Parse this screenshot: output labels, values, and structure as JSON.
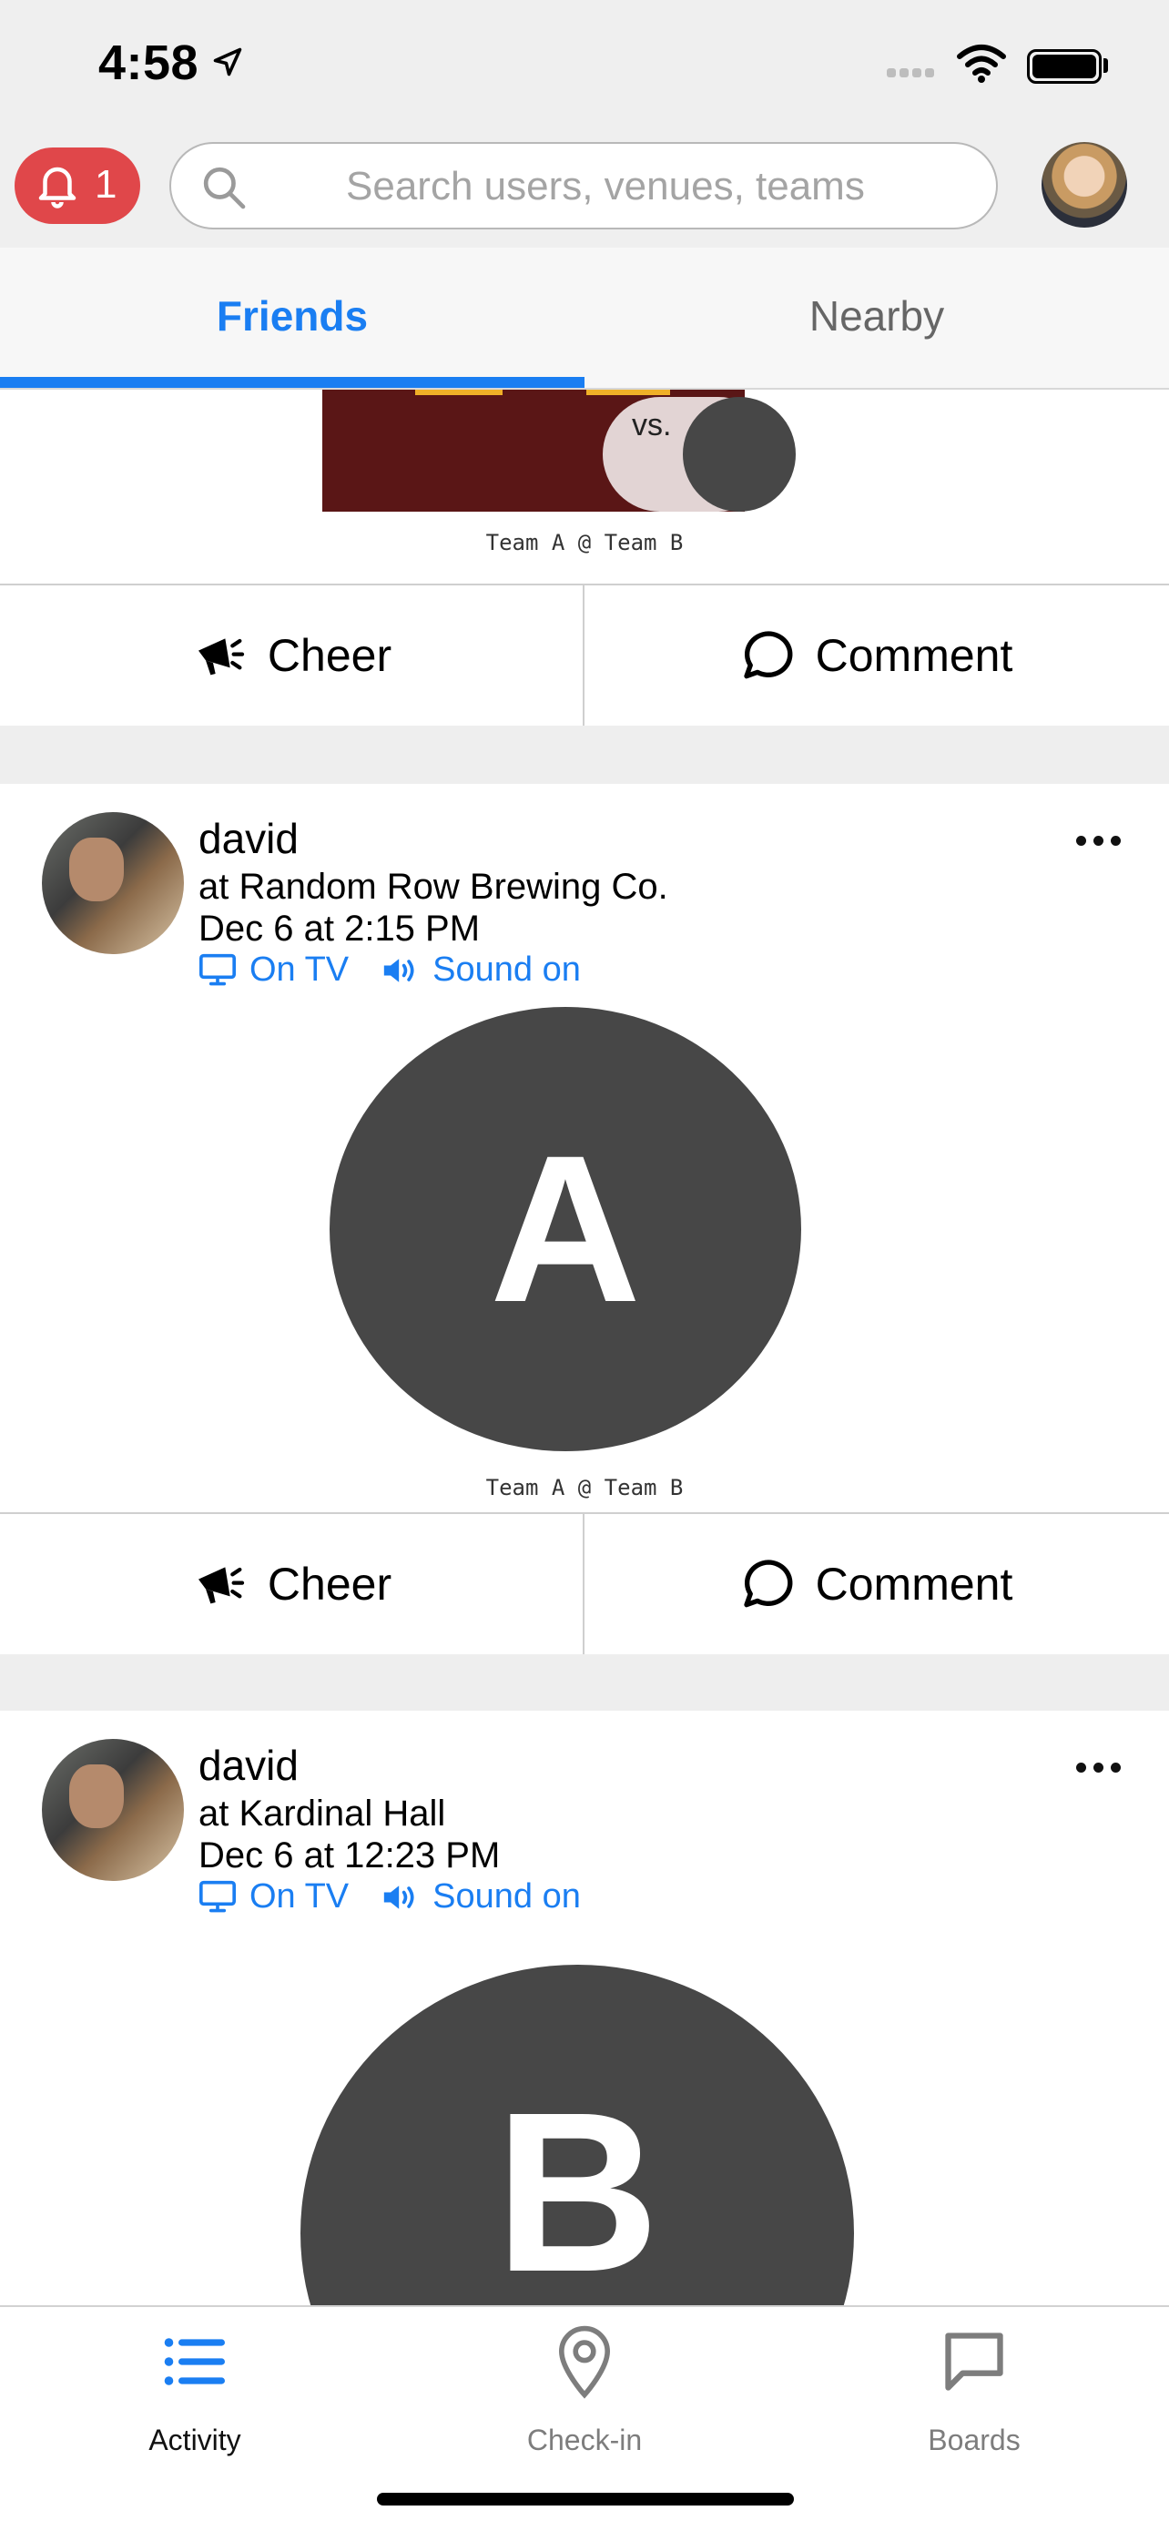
{
  "status_bar": {
    "time": "4:58"
  },
  "header": {
    "notification_count": "1",
    "search_placeholder": "Search users, venues, teams"
  },
  "tabs": {
    "friends": "Friends",
    "nearby": "Nearby"
  },
  "posts": [
    {
      "caption": "Team A @ Team B",
      "vs": "vs.",
      "cheer": "Cheer",
      "comment": "Comment"
    },
    {
      "user": "david",
      "venue": "at Random Row Brewing Co.",
      "time": "Dec 6 at 2:15 PM",
      "on_tv": "On TV",
      "sound": "Sound on",
      "team_letter": "A",
      "caption": "Team A @ Team B",
      "cheer": "Cheer",
      "comment": "Comment"
    },
    {
      "user": "david",
      "venue": "at Kardinal Hall",
      "time": "Dec 6 at 12:23 PM",
      "on_tv": "On TV",
      "sound": "Sound on",
      "team_letter": "B"
    }
  ],
  "tabbar": {
    "activity": "Activity",
    "checkin": "Check-in",
    "boards": "Boards"
  },
  "colors": {
    "accent": "#1a7ef2",
    "notification": "#e0474a",
    "team_circle": "#474747"
  }
}
